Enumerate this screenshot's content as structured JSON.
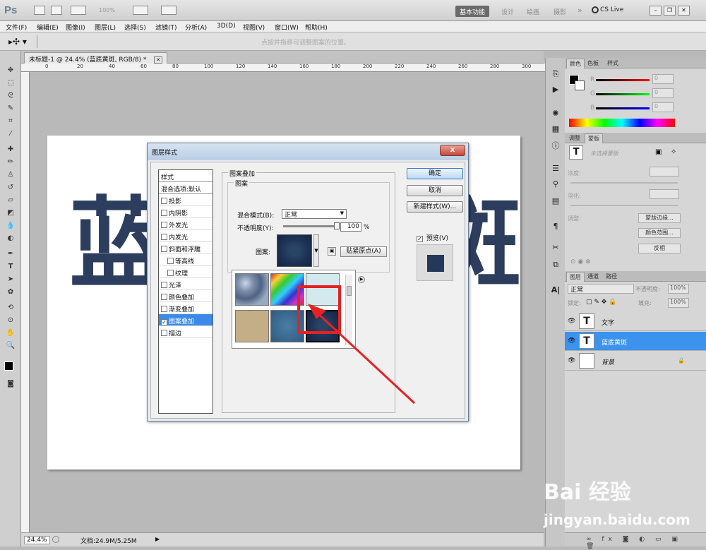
{
  "app": {
    "logo": "Ps",
    "zoom_display": "100%"
  },
  "workspace": {
    "active": "基本功能",
    "items": [
      "设计",
      "绘画",
      "摄影"
    ],
    "more": "»",
    "cslive": "CS Live"
  },
  "menu": [
    "文件(F)",
    "编辑(E)",
    "图像(I)",
    "图层(L)",
    "选择(S)",
    "滤镜(T)",
    "分析(A)",
    "3D(D)",
    "视图(V)",
    "窗口(W)",
    "帮助(H)"
  ],
  "options": {
    "hint": "点按并拖移可调整图案的位置。"
  },
  "document": {
    "tab": "未标题-1 @ 24.4% (蓝底黄斑, RGB/8) *",
    "ruler_h": [
      "0",
      "20",
      "40",
      "60",
      "80",
      "100",
      "120",
      "140",
      "160",
      "180",
      "200",
      "220",
      "240",
      "260",
      "280",
      "300"
    ],
    "canvas_text_left": "蓝",
    "canvas_text_right": "斑",
    "zoom": "24.4%",
    "docinfo": "文档:24.9M/5.25M"
  },
  "color_panel": {
    "tabs": [
      "颜色",
      "色板",
      "样式"
    ],
    "channels": [
      {
        "label": "R",
        "value": "0"
      },
      {
        "label": "G",
        "value": "0"
      },
      {
        "label": "B",
        "value": "0"
      }
    ]
  },
  "adjust_panel": {
    "tabs": [
      "调整",
      "蒙版"
    ],
    "hint": "未选择蒙版",
    "density": "浓度:",
    "feather": "羽化:",
    "refine": "调整:",
    "btn_mask_edge": "蒙版边缘...",
    "btn_color_range": "颜色范围...",
    "btn_invert": "反相"
  },
  "layers_panel": {
    "tabs": [
      "图层",
      "通道",
      "路径"
    ],
    "blend": "正常",
    "opacity_label": "不透明度:",
    "opacity": "100%",
    "lock_label": "锁定:",
    "fill_label": "填充:",
    "fill": "100%",
    "layers": [
      {
        "name": "文字",
        "thumb": "T",
        "selected": false
      },
      {
        "name": "蓝底黄斑",
        "thumb": "T",
        "selected": true
      },
      {
        "name": "背景",
        "thumb": "",
        "selected": false
      }
    ]
  },
  "dialog": {
    "title": "图层样式",
    "close": "x",
    "styles_header": "样式",
    "blend_default": "混合选项:默认",
    "styles": [
      {
        "label": "投影",
        "checked": false,
        "indent": false,
        "selected": false
      },
      {
        "label": "内阴影",
        "checked": false,
        "indent": false,
        "selected": false
      },
      {
        "label": "外发光",
        "checked": false,
        "indent": false,
        "selected": false
      },
      {
        "label": "内发光",
        "checked": false,
        "indent": false,
        "selected": false
      },
      {
        "label": "斜面和浮雕",
        "checked": false,
        "indent": false,
        "selected": false
      },
      {
        "label": "等高线",
        "checked": false,
        "indent": true,
        "selected": false
      },
      {
        "label": "纹理",
        "checked": false,
        "indent": true,
        "selected": false
      },
      {
        "label": "光泽",
        "checked": false,
        "indent": false,
        "selected": false
      },
      {
        "label": "颜色叠加",
        "checked": false,
        "indent": false,
        "selected": false
      },
      {
        "label": "渐变叠加",
        "checked": false,
        "indent": false,
        "selected": false
      },
      {
        "label": "图案叠加",
        "checked": true,
        "indent": false,
        "selected": true
      },
      {
        "label": "描边",
        "checked": false,
        "indent": false,
        "selected": false
      }
    ],
    "section_title": "图案叠加",
    "group_title": "图案",
    "blend_label": "混合模式(B):",
    "blend_value": "正常",
    "opacity_label": "不透明度(Y):",
    "opacity_value": "100",
    "opacity_unit": "%",
    "pattern_label": "图案:",
    "snap_button": "贴紧原点(A)",
    "ok": "确定",
    "cancel": "取消",
    "new_style": "新建样式(W)...",
    "preview": "预览(V)"
  },
  "watermark": {
    "line1": "Bai 经验",
    "line2": "jingyan.baidu.com"
  },
  "colors": {
    "accent": "#3c93ee",
    "highlight": "#e52222",
    "text_fill": "#2c3d5e"
  }
}
